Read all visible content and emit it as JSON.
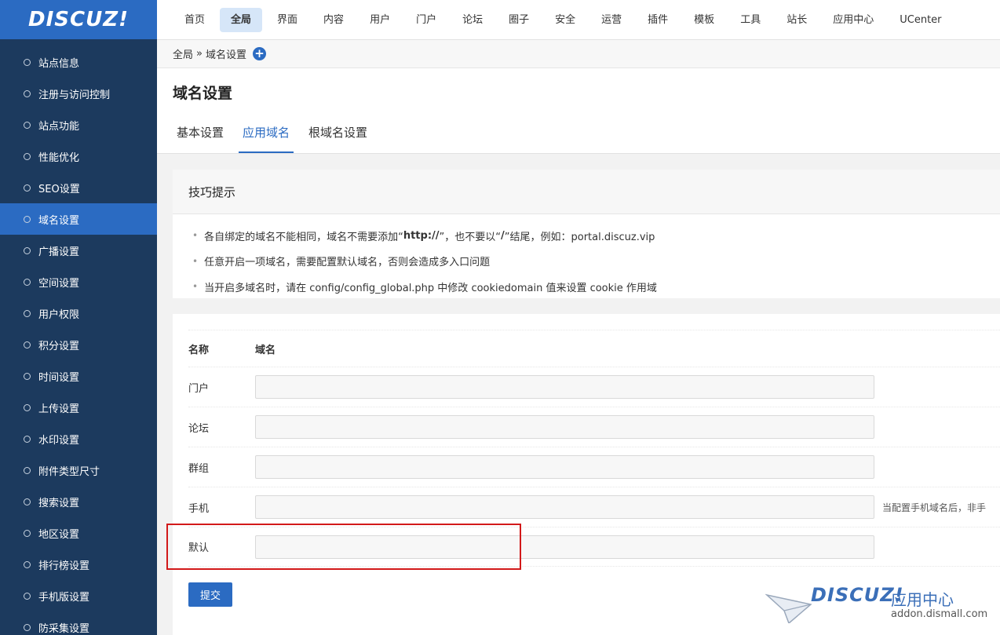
{
  "logo": "DISCUZ!",
  "topnav": [
    "首页",
    "全局",
    "界面",
    "内容",
    "用户",
    "门户",
    "论坛",
    "圈子",
    "安全",
    "运营",
    "插件",
    "模板",
    "工具",
    "站长",
    "应用中心",
    "UCenter"
  ],
  "topnav_active": "全局",
  "sidebar": {
    "items": [
      {
        "label": "站点信息"
      },
      {
        "label": "注册与访问控制"
      },
      {
        "label": "站点功能"
      },
      {
        "label": "性能优化"
      },
      {
        "label": "SEO设置"
      },
      {
        "label": "域名设置"
      },
      {
        "label": "广播设置"
      },
      {
        "label": "空间设置"
      },
      {
        "label": "用户权限"
      },
      {
        "label": "积分设置"
      },
      {
        "label": "时间设置"
      },
      {
        "label": "上传设置"
      },
      {
        "label": "水印设置"
      },
      {
        "label": "附件类型尺寸"
      },
      {
        "label": "搜索设置"
      },
      {
        "label": "地区设置"
      },
      {
        "label": "排行榜设置"
      },
      {
        "label": "手机版设置"
      },
      {
        "label": "防采集设置"
      }
    ],
    "active": "域名设置"
  },
  "breadcrumb": {
    "parent": "全局",
    "sep": "»",
    "current": "域名设置",
    "add_icon": "plus-circle-icon"
  },
  "page_title": "域名设置",
  "tabs": [
    {
      "label": "基本设置"
    },
    {
      "label": "应用域名"
    },
    {
      "label": "根域名设置"
    }
  ],
  "tabs_active": "应用域名",
  "tips": {
    "title": "技巧提示",
    "items": [
      {
        "pre": "各自绑定的域名不能相同，域名不需要添加“",
        "bold": "http://",
        "mid": "”，也不要以“",
        "bold2": "/",
        "post": "”结尾，例如：portal.discuz.vip"
      },
      {
        "text": "任意开启一项域名，需要配置默认域名，否则会造成多入口问题"
      },
      {
        "text": "当开启多域名时，请在 config/config_global.php 中修改 cookiedomain 值来设置 cookie 作用域"
      }
    ]
  },
  "form": {
    "headers": {
      "name": "名称",
      "domain": "域名"
    },
    "rows": [
      {
        "name": "门户",
        "value": ""
      },
      {
        "name": "论坛",
        "value": ""
      },
      {
        "name": "群组",
        "value": ""
      },
      {
        "name": "手机",
        "value": "",
        "note": "当配置手机域名后，非手"
      },
      {
        "name": "默认",
        "value": ""
      }
    ],
    "submit": "提交"
  },
  "watermark": {
    "logo": "DISCUZ!",
    "text": "应用中心",
    "url": "addon.dismall.com"
  },
  "colors": {
    "sidebar": "#1c3a5e",
    "accent": "#2b6bc2",
    "highlight": "#d2191a"
  }
}
